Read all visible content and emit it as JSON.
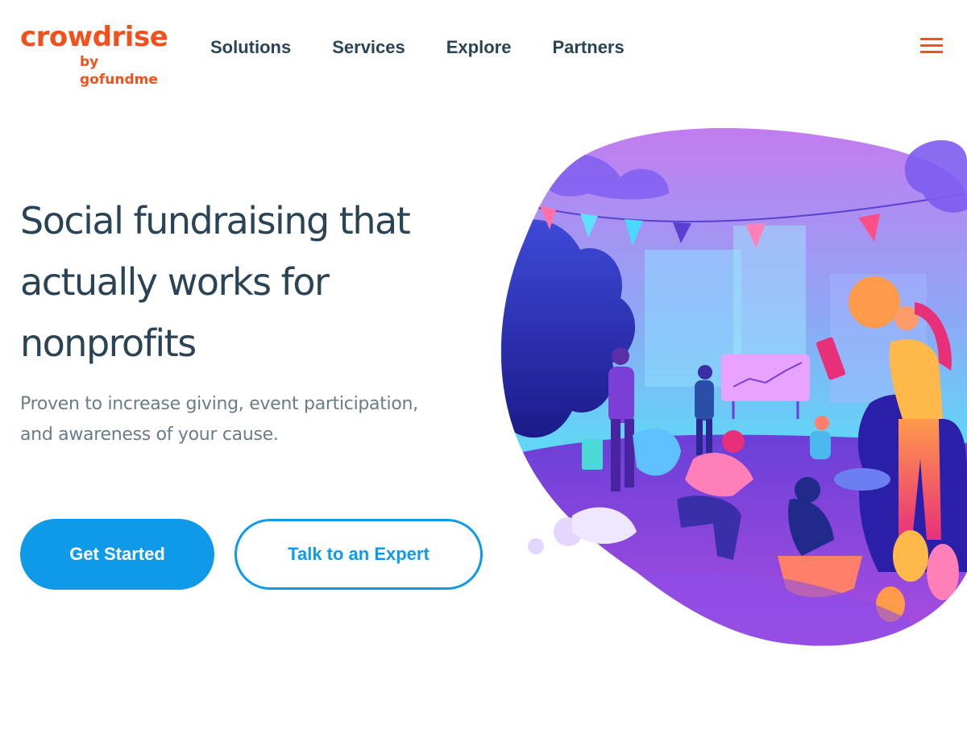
{
  "brand": {
    "name": "crowdrise",
    "tagline": "by gofundme",
    "color": "#f2511b"
  },
  "nav": {
    "items": [
      "Solutions",
      "Services",
      "Explore",
      "Partners"
    ]
  },
  "menu_icon": "hamburger-menu-icon",
  "hero": {
    "headline_lines": [
      "Social fundraising that",
      "actually works for",
      "nonprofits"
    ],
    "subtext_lines": [
      "Proven to increase giving, event participation,",
      "and awareness of your cause."
    ],
    "primary_button": "Get Started",
    "secondary_button": "Talk to an Expert"
  },
  "colors": {
    "accent_blue": "#0f9ae9",
    "heading": "#2a4455",
    "body_text": "#6b7c86"
  },
  "illustration": "community-fundraising-event-with-dogs-illustration"
}
